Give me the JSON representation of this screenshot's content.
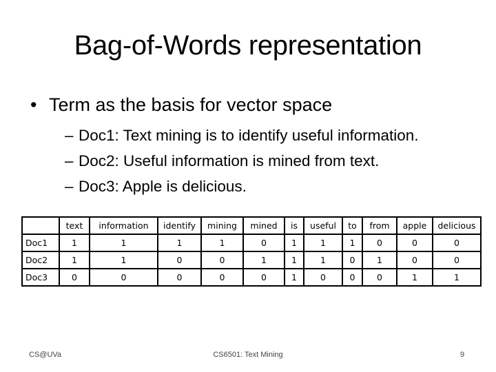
{
  "slide": {
    "title": "Bag-of-Words representation",
    "bullet": "Term as the basis for vector space",
    "bullet_marker": "•",
    "sub_marker": "–",
    "sub_bullets": [
      "Doc1: Text mining is to identify useful information.",
      "Doc2: Useful information is mined from text.",
      "Doc3: Apple is delicious."
    ]
  },
  "table": {
    "corner": "",
    "columns": [
      "text",
      "information",
      "identify",
      "mining",
      "mined",
      "is",
      "useful",
      "to",
      "from",
      "apple",
      "delicious"
    ],
    "rows": [
      {
        "label": "Doc1",
        "values": [
          "1",
          "1",
          "1",
          "1",
          "0",
          "1",
          "1",
          "1",
          "0",
          "0",
          "0"
        ]
      },
      {
        "label": "Doc2",
        "values": [
          "1",
          "1",
          "0",
          "0",
          "1",
          "1",
          "1",
          "0",
          "1",
          "0",
          "0"
        ]
      },
      {
        "label": "Doc3",
        "values": [
          "0",
          "0",
          "0",
          "0",
          "0",
          "1",
          "0",
          "0",
          "0",
          "1",
          "1"
        ]
      }
    ]
  },
  "footer": {
    "left": "CS@UVa",
    "center": "CS6501: Text Mining",
    "page_number": "9"
  }
}
